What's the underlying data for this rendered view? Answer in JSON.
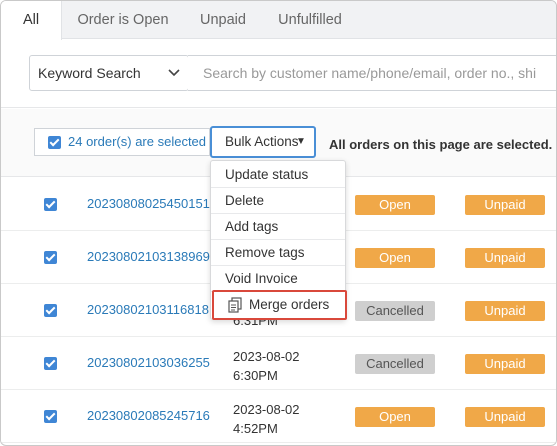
{
  "tabs": [
    {
      "label": "All",
      "active": true
    },
    {
      "label": "Order is Open"
    },
    {
      "label": "Unpaid"
    },
    {
      "label": "Unfulfilled"
    }
  ],
  "search": {
    "field_select": "Keyword Search",
    "placeholder": "Search by customer name/phone/email, order no., shi"
  },
  "selection": {
    "count_text": "24 order(s) are selected",
    "bulk_actions_label": "Bulk Actions",
    "all_selected_text": "All orders on this page are selected."
  },
  "bulk_menu": {
    "items": [
      "Update status",
      "Delete",
      "Add tags",
      "Remove tags",
      "Void Invoice",
      "Merge orders"
    ],
    "highlighted_item": "Merge orders"
  },
  "orders": [
    {
      "order_no": "20230808025450151",
      "date": "",
      "time": "",
      "status": "Open",
      "payment": "Unpaid"
    },
    {
      "order_no": "20230802103138969",
      "date": "",
      "time": "",
      "status": "Open",
      "payment": "Unpaid"
    },
    {
      "order_no": "20230802103116818",
      "date": "",
      "time": "6:31PM",
      "status": "Cancelled",
      "payment": "Unpaid"
    },
    {
      "order_no": "20230802103036255",
      "date": "2023-08-02",
      "time": "6:30PM",
      "status": "Cancelled",
      "payment": "Unpaid"
    },
    {
      "order_no": "20230802085245716",
      "date": "2023-08-02",
      "time": "4:52PM",
      "status": "Open",
      "payment": "Unpaid"
    }
  ],
  "colors": {
    "link_blue": "#2a7ab8",
    "checkbox_blue": "#3f86d5",
    "badge_orange": "#f0a848",
    "badge_grey": "#cfcfcf",
    "highlight_red": "#d9483b"
  }
}
